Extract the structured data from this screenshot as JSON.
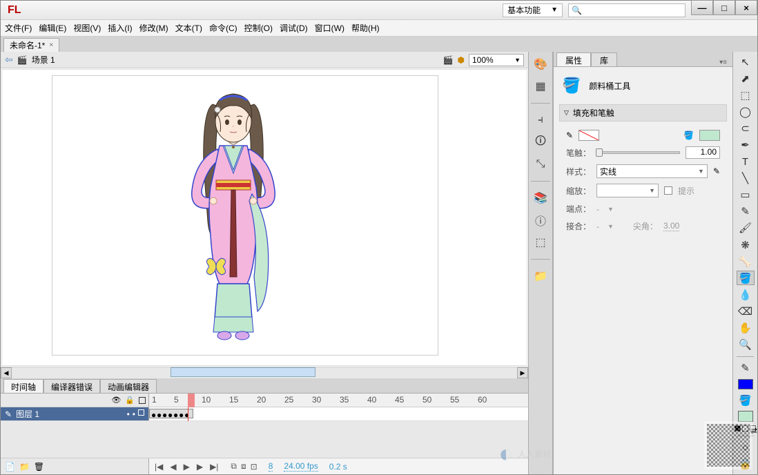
{
  "app": {
    "logo": "FL"
  },
  "workspace": {
    "label": "基本功能"
  },
  "search": {
    "placeholder": ""
  },
  "window_buttons": {
    "min": "—",
    "max": "□",
    "close": "×"
  },
  "menu": {
    "file": "文件(F)",
    "edit": "编辑(E)",
    "view": "视图(V)",
    "insert": "插入(I)",
    "modify": "修改(M)",
    "text": "文本(T)",
    "commands": "命令(C)",
    "control": "控制(O)",
    "debug": "调试(D)",
    "window": "窗口(W)",
    "help": "帮助(H)"
  },
  "doc": {
    "tab": "未命名-1*"
  },
  "stage": {
    "scene": "场景 1",
    "zoom": "100%"
  },
  "bottom_tabs": {
    "timeline": "时间轴",
    "errors": "编译器错误",
    "motion": "动画编辑器"
  },
  "timeline": {
    "layer": "图层 1",
    "ruler": [
      "1",
      "5",
      "10",
      "15",
      "20",
      "25",
      "30",
      "35",
      "40",
      "45",
      "50",
      "55",
      "60"
    ],
    "frame": "8",
    "fps": "24.00 fps",
    "time": "0.2 s"
  },
  "props": {
    "tabs": {
      "properties": "属性",
      "library": "库"
    },
    "tool_name": "颜料桶工具",
    "section": "填充和笔触",
    "stroke_label": "笔触：",
    "stroke_value": "1.00",
    "style_label": "样式：",
    "style_value": "实线",
    "scale_label": "缩放：",
    "hint_label": "提示",
    "cap_label": "端点：",
    "join_label": "接合：",
    "miter_label": "尖角：",
    "miter_value": "3.00",
    "dash": "-"
  },
  "colors": {
    "stroke_swatch": "none",
    "fill_swatch": "#bfe8cf",
    "tool_stroke": "#0000ff",
    "tool_fill": "#bfe8cf"
  },
  "watermark": "人人素材"
}
